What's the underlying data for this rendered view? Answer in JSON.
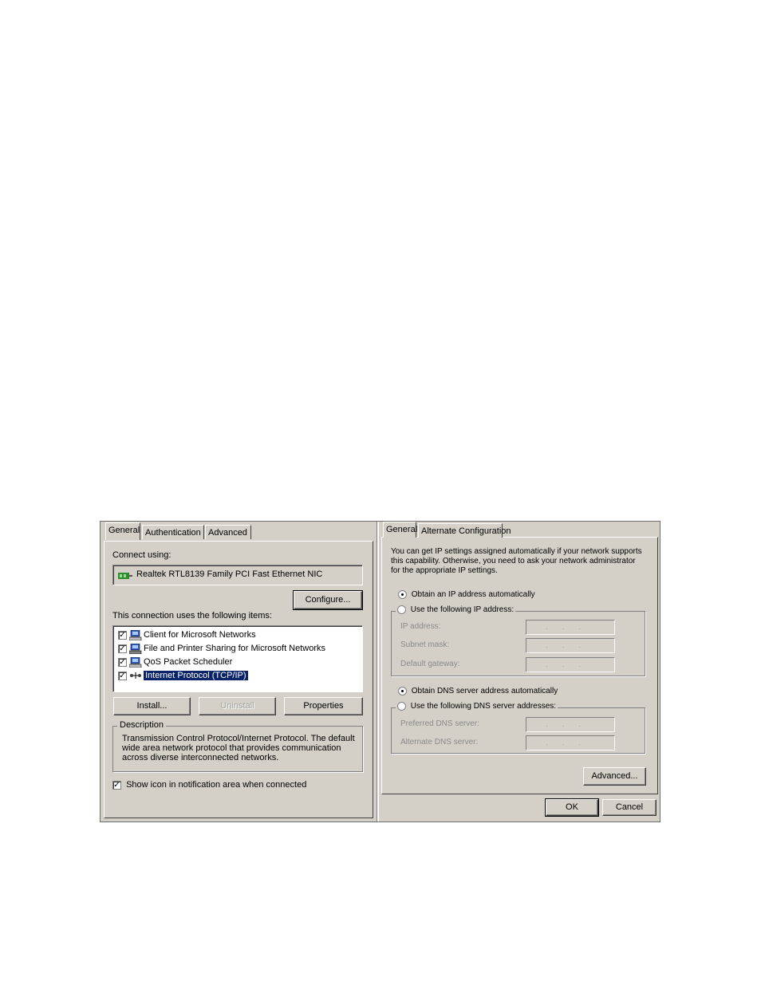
{
  "left_dialog": {
    "tabs": [
      "General",
      "Authentication",
      "Advanced"
    ],
    "connect_using_label": "Connect using:",
    "adapter_name": "Realtek RTL8139 Family PCI Fast Ethernet NIC",
    "configure_button": "Configure...",
    "items_label": "This connection uses the following items:",
    "items": [
      {
        "label": "Client for Microsoft Networks",
        "checked": true,
        "icon": "network-client-icon"
      },
      {
        "label": "File and Printer Sharing for Microsoft Networks",
        "checked": true,
        "icon": "file-printer-sharing-icon"
      },
      {
        "label": "QoS Packet Scheduler",
        "checked": true,
        "icon": "qos-scheduler-icon"
      },
      {
        "label": "Internet Protocol (TCP/IP)",
        "checked": true,
        "icon": "network-protocol-icon",
        "selected": true
      }
    ],
    "install_button": "Install...",
    "uninstall_button": "Uninstall",
    "properties_button": "Properties",
    "description_title": "Description",
    "description_text": "Transmission Control Protocol/Internet Protocol. The default wide area network protocol that provides communication across diverse interconnected networks.",
    "show_icon_label": "Show icon in notification area when connected",
    "show_icon_checked": true
  },
  "right_dialog": {
    "tabs": [
      "General",
      "Alternate Configuration"
    ],
    "intro_text": "You can get IP settings assigned automatically if your network supports this capability. Otherwise, you need to ask your network administrator for the appropriate IP settings.",
    "obtain_ip_auto": "Obtain an IP address automatically",
    "use_following_ip": "Use the following IP address:",
    "ip_address_label": "IP address:",
    "subnet_mask_label": "Subnet mask:",
    "default_gateway_label": "Default gateway:",
    "obtain_dns_auto": "Obtain DNS server address automatically",
    "use_following_dns": "Use the following DNS server addresses:",
    "preferred_dns_label": "Preferred DNS server:",
    "alternate_dns_label": "Alternate DNS server:",
    "ip_field_dots": "...",
    "advanced_button": "Advanced...",
    "ok_button": "OK",
    "cancel_button": "Cancel"
  },
  "colors": {
    "selection": "#0a246a",
    "dialog_bg": "#d4d0c8"
  }
}
